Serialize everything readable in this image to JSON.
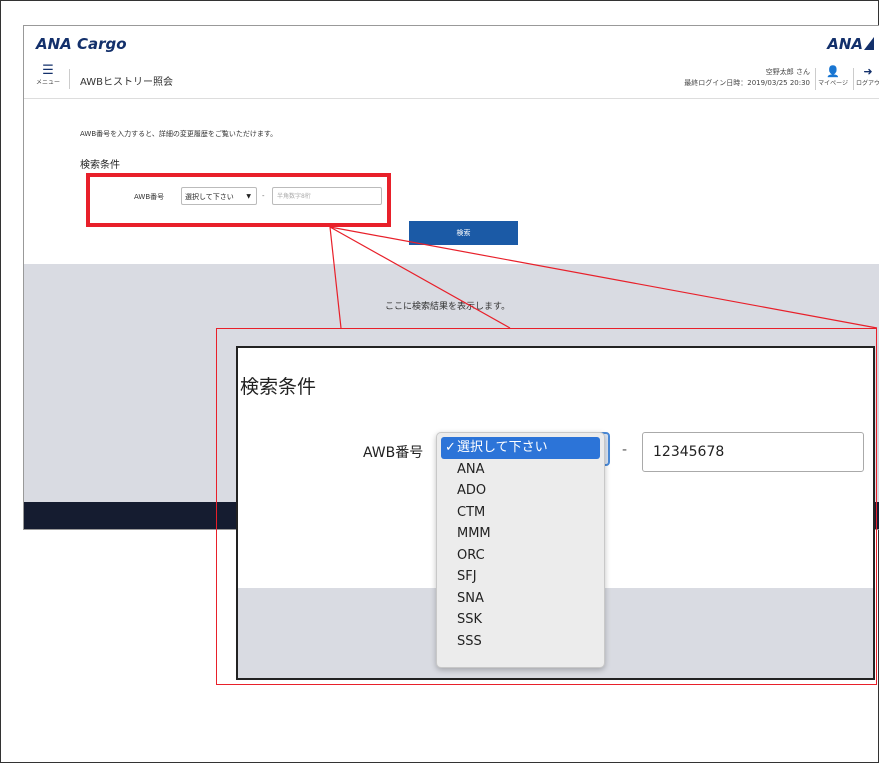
{
  "header": {
    "brand": "ANA Cargo",
    "brand_right": "ANA",
    "menu_label": "メニュー",
    "page_title": "AWBヒストリー照会",
    "user_name": "空野太郎 さん",
    "last_login": "最終ログイン日時：2019/03/25 20:30",
    "mypage_label": "マイページ",
    "logout_label": "ログアウ"
  },
  "main": {
    "description": "AWB番号を入力すると、詳細の変更履歴をご覧いただけます。",
    "condition_title": "検索条件",
    "awb_label": "AWB番号",
    "prefix_select_value": "選択して下さい",
    "separator": "-",
    "number_placeholder": "半角数字8桁",
    "search_button": "検索",
    "results_message": "ここに検索結果を表示します。"
  },
  "zoom": {
    "condition_title": "検索条件",
    "awb_label": "AWB番号",
    "separator": "-",
    "number_value": "12345678",
    "options": [
      {
        "label": "選択して下さい",
        "selected": true
      },
      {
        "label": "ANA",
        "selected": false
      },
      {
        "label": "ADO",
        "selected": false
      },
      {
        "label": "CTM",
        "selected": false
      },
      {
        "label": "MMM",
        "selected": false
      },
      {
        "label": "ORC",
        "selected": false
      },
      {
        "label": "SFJ",
        "selected": false
      },
      {
        "label": "SNA",
        "selected": false
      },
      {
        "label": "SSK",
        "selected": false
      },
      {
        "label": "SSS",
        "selected": false
      }
    ],
    "checkmark": "✓"
  },
  "colors": {
    "brand_navy": "#13306b",
    "button_blue": "#1b5aa6",
    "callout_red": "#e8202a",
    "results_gray": "#d9dbe2",
    "footer_dark": "#151c30",
    "selected_option": "#2c74d8"
  }
}
